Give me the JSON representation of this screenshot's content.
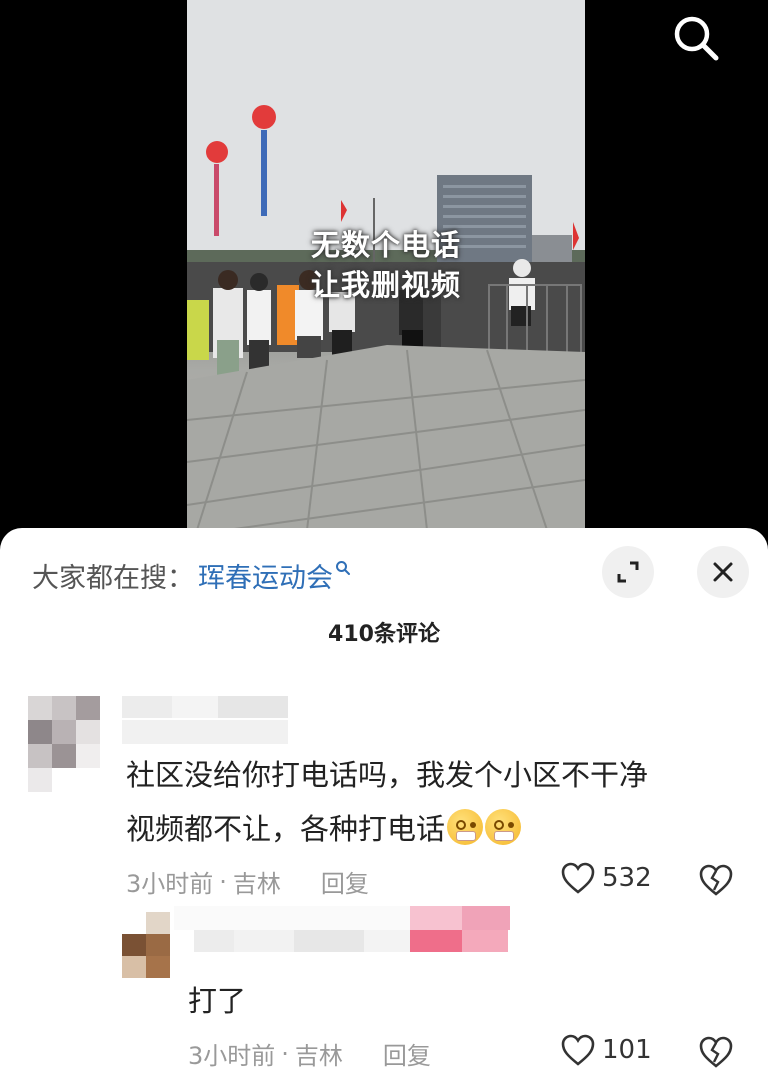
{
  "video": {
    "overlay_line1": "无数个电话",
    "overlay_line2": "让我删视频",
    "search_icon": "search-icon"
  },
  "sheet": {
    "hot_search_prefix": "大家都在搜：",
    "hot_search_keyword": "珲春运动会",
    "expand_icon": "expand-icon",
    "close_icon": "close-icon",
    "comment_count": "410条评论"
  },
  "comments": [
    {
      "text_line1": "社区没给你打电话吗，我发个小区不干净",
      "text_line2": "视频都不让，各种打电话",
      "time": "3小时前",
      "location": "吉林",
      "reply_label": "回复",
      "likes": "532"
    },
    {
      "text": "打了",
      "time": "3小时前",
      "location": "吉林",
      "reply_label": "回复",
      "likes": "101"
    }
  ],
  "meta_separator": "·",
  "colors": {
    "keyword": "#2f6fb7",
    "sheet_bg": "#ffffff",
    "page_bg": "#000000"
  }
}
